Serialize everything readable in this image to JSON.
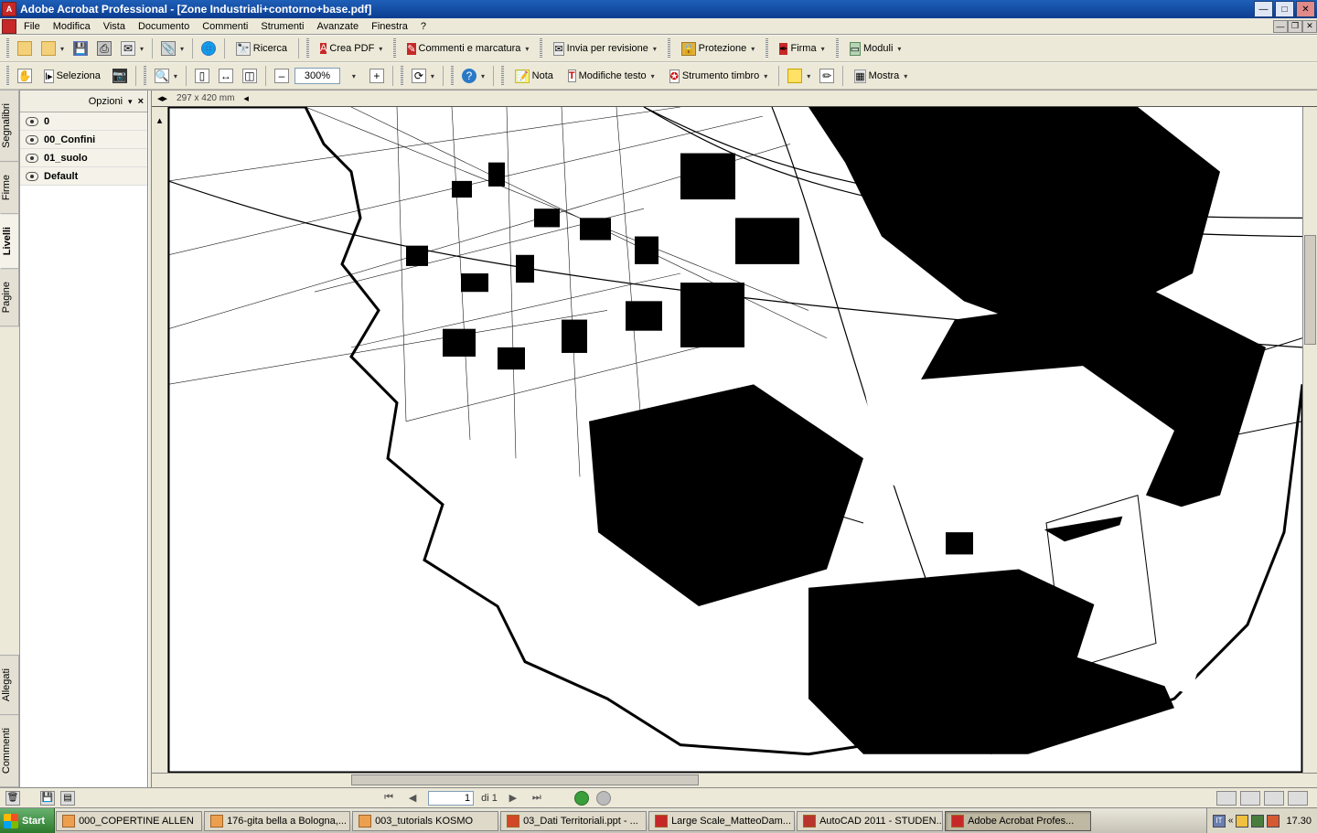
{
  "title": "Adobe Acrobat Professional - [Zone Industriali+contorno+base.pdf]",
  "menu": [
    "File",
    "Modifica",
    "Vista",
    "Documento",
    "Commenti",
    "Strumenti",
    "Avanzate",
    "Finestra",
    "?"
  ],
  "toolbar1": {
    "ricerca": "Ricerca",
    "creapdf": "Crea PDF",
    "commenti": "Commenti e marcatura",
    "invia": "Invia per revisione",
    "protezione": "Protezione",
    "firma": "Firma",
    "moduli": "Moduli"
  },
  "toolbar2": {
    "seleziona": "Seleziona",
    "zoom": "300%",
    "nota": "Nota",
    "modtesto": "Modifiche testo",
    "timbro": "Strumento timbro",
    "mostra": "Mostra"
  },
  "panel": {
    "opzioni": "Opzioni",
    "layers": [
      {
        "name": "0"
      },
      {
        "name": "00_Confini"
      },
      {
        "name": "01_suolo"
      },
      {
        "name": "Default"
      }
    ]
  },
  "sidetabs": [
    "Segnalibri",
    "Firme",
    "Livelli",
    "Pagine",
    "Allegati",
    "Commenti"
  ],
  "ruler": {
    "dims": "297 x 420 mm"
  },
  "nav": {
    "page": "1",
    "of": "di 1"
  },
  "taskbar": {
    "start": "Start",
    "items": [
      {
        "label": "000_COPERTINE ALLEN",
        "type": "folder"
      },
      {
        "label": "176-gita bella a Bologna,...",
        "type": "folder"
      },
      {
        "label": "003_tutorials KOSMO",
        "type": "folder"
      },
      {
        "label": "03_Dati Territoriali.ppt - ...",
        "type": "ppt"
      },
      {
        "label": "Large Scale_MatteoDam...",
        "type": "pdf"
      },
      {
        "label": "AutoCAD 2011 - STUDEN...",
        "type": "acad"
      },
      {
        "label": "Adobe Acrobat Profes...",
        "type": "pdf",
        "active": true
      }
    ],
    "clock": "17.30"
  }
}
